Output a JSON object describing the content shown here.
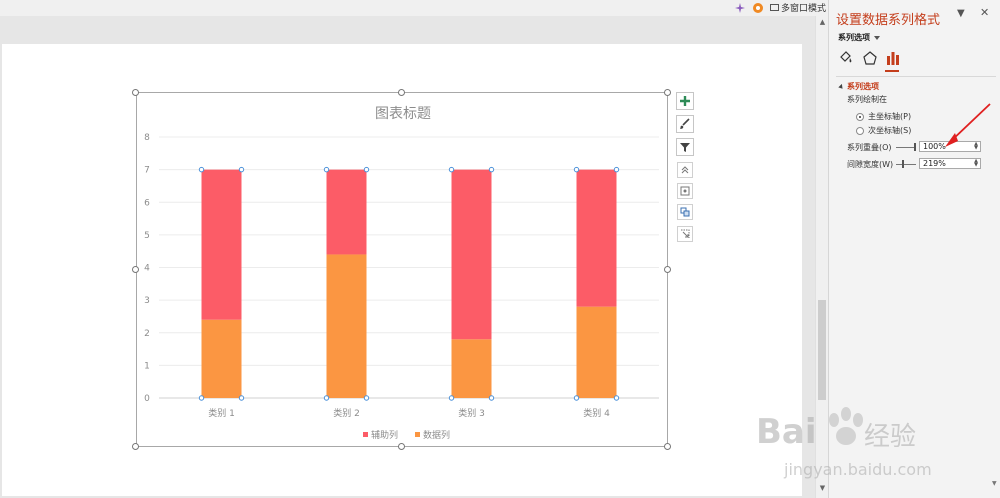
{
  "topbar": {
    "multi_window_label": "多窗口模式"
  },
  "chart_data": {
    "type": "bar",
    "stacked": true,
    "title": "图表标题",
    "categories": [
      "类别 1",
      "类别 2",
      "类别 3",
      "类别 4"
    ],
    "ylim": [
      0,
      8
    ],
    "yticks": [
      "0",
      "1",
      "2",
      "3",
      "4",
      "5",
      "6",
      "7",
      "8"
    ],
    "grid": true,
    "legend_position": "bottom",
    "series": [
      {
        "name": "数据列",
        "values": [
          2.4,
          4.4,
          1.8,
          2.8
        ],
        "color": "#fb9642"
      },
      {
        "name": "辅助列",
        "values": [
          4.6,
          2.6,
          5.2,
          4.2
        ],
        "color": "#fc5c67"
      }
    ]
  },
  "pane": {
    "title": "设置数据系列格式",
    "subtitle": "系列选项",
    "tabs": [
      "fill-line-icon",
      "effects-icon",
      "series-options-icon"
    ],
    "section": {
      "title": "系列选项",
      "plot_on_label": "系列绘制在",
      "primary_axis_label": "主坐标轴(P)",
      "secondary_axis_label": "次坐标轴(S)",
      "selected_axis": "primary",
      "overlap_label": "系列重叠(O)",
      "overlap_value": "100%",
      "gap_label": "间隙宽度(W)",
      "gap_value": "219%"
    }
  },
  "watermark": {
    "brand": "Bai",
    "brand_tail": "经验",
    "url": "jingyan.baidu.com"
  },
  "colors": {
    "accent": "#c43e1c",
    "series_orange": "#fb9642",
    "series_red": "#fc5c67",
    "selection_handle": "#4a90d9"
  }
}
